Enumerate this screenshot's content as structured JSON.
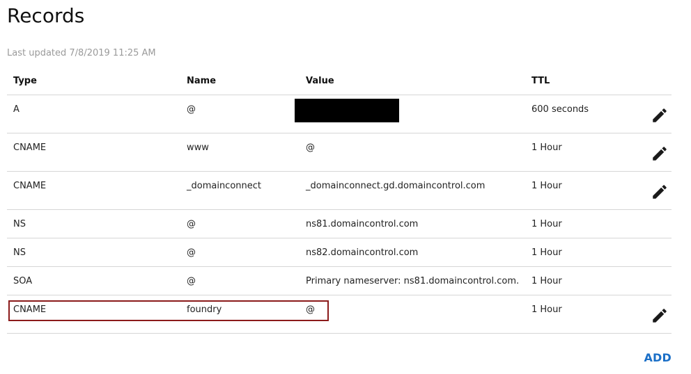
{
  "page": {
    "title": "Records",
    "last_updated": "Last updated 7/8/2019 11:25 AM"
  },
  "table": {
    "headers": {
      "type": "Type",
      "name": "Name",
      "value": "Value",
      "ttl": "TTL"
    },
    "rows": [
      {
        "type": "A",
        "name": "@",
        "value": "",
        "ttl": "600 seconds",
        "editable": true,
        "value_redacted": true
      },
      {
        "type": "CNAME",
        "name": "www",
        "value": "@",
        "ttl": "1 Hour",
        "editable": true
      },
      {
        "type": "CNAME",
        "name": "_domainconnect",
        "value": "_domainconnect.gd.domaincontrol.com",
        "ttl": "1 Hour",
        "editable": true
      },
      {
        "type": "NS",
        "name": "@",
        "value": "ns81.domaincontrol.com",
        "ttl": "1 Hour",
        "editable": false
      },
      {
        "type": "NS",
        "name": "@",
        "value": "ns82.domaincontrol.com",
        "ttl": "1 Hour",
        "editable": false
      },
      {
        "type": "SOA",
        "name": "@",
        "value": "Primary nameserver: ns81.domaincontrol.com.",
        "ttl": "1 Hour",
        "editable": false
      },
      {
        "type": "CNAME",
        "name": "foundry",
        "value": "@",
        "ttl": "1 Hour",
        "editable": true,
        "highlighted": true
      }
    ]
  },
  "actions": {
    "add_label": "ADD"
  },
  "icons": {
    "edit": "pencil-icon"
  },
  "colors": {
    "accent_link": "#1b6fc7",
    "highlight_border": "#8b1a1a",
    "divider": "#d6d6d6",
    "muted_text": "#9a9a9a"
  }
}
